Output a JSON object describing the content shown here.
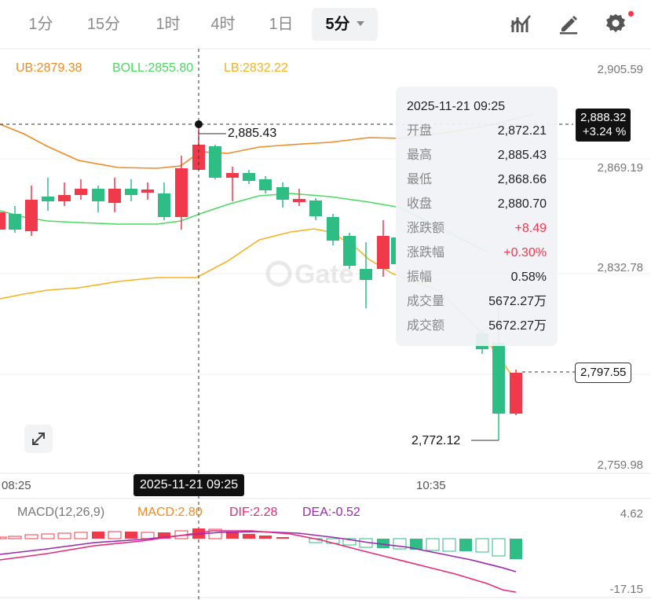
{
  "toolbar": {
    "timeframes": [
      "1分",
      "15分",
      "1时",
      "4时",
      "1日"
    ],
    "active_timeframe": "5分",
    "icons": [
      "indicator-icon",
      "draw-icon",
      "settings-icon"
    ]
  },
  "indicators": {
    "ub": "UB:2879.38",
    "boll": "BOLL:2855.80",
    "lb": "LB:2832.22"
  },
  "price_axis": [
    "2,905.59",
    "2,869.19",
    "2,832.78",
    "2,759.98"
  ],
  "current_price": {
    "price": "2,888.32",
    "change": "+3.24 %"
  },
  "last_price": "2,797.55",
  "high_marker": "2,885.43",
  "low_marker": "2,772.12",
  "tooltip": {
    "date": "2025-11-21 09:25",
    "rows": [
      {
        "label": "开盘",
        "value": "2,872.21"
      },
      {
        "label": "最高",
        "value": "2,885.43"
      },
      {
        "label": "最低",
        "value": "2,868.66"
      },
      {
        "label": "收盘",
        "value": "2,880.70"
      },
      {
        "label": "涨跌额",
        "value": "+8.49"
      },
      {
        "label": "涨跌幅",
        "value": "+0.30%"
      },
      {
        "label": "振幅",
        "value": "0.58%"
      },
      {
        "label": "成交量",
        "value": "5672.27万"
      },
      {
        "label": "成交额",
        "value": "5672.27万"
      }
    ]
  },
  "time_axis": {
    "start": "08:25",
    "mid": "10:35",
    "crosshair": "2025-11-21 09:25"
  },
  "macd": {
    "title": "MACD(12,26,9)",
    "macd": "MACD:2.80",
    "dif": "DIF:2.28",
    "dea": "DEA:-0.52",
    "axis_top": "4.62",
    "axis_bottom": "-17.15"
  },
  "watermark": "Gate",
  "colors": {
    "up": "#f0394b",
    "down": "#2ebd85",
    "ub": "#f08a24",
    "boll": "#4cd964",
    "lb": "#f5b324",
    "dif": "#e6297a",
    "dea": "#9c27b0"
  }
}
